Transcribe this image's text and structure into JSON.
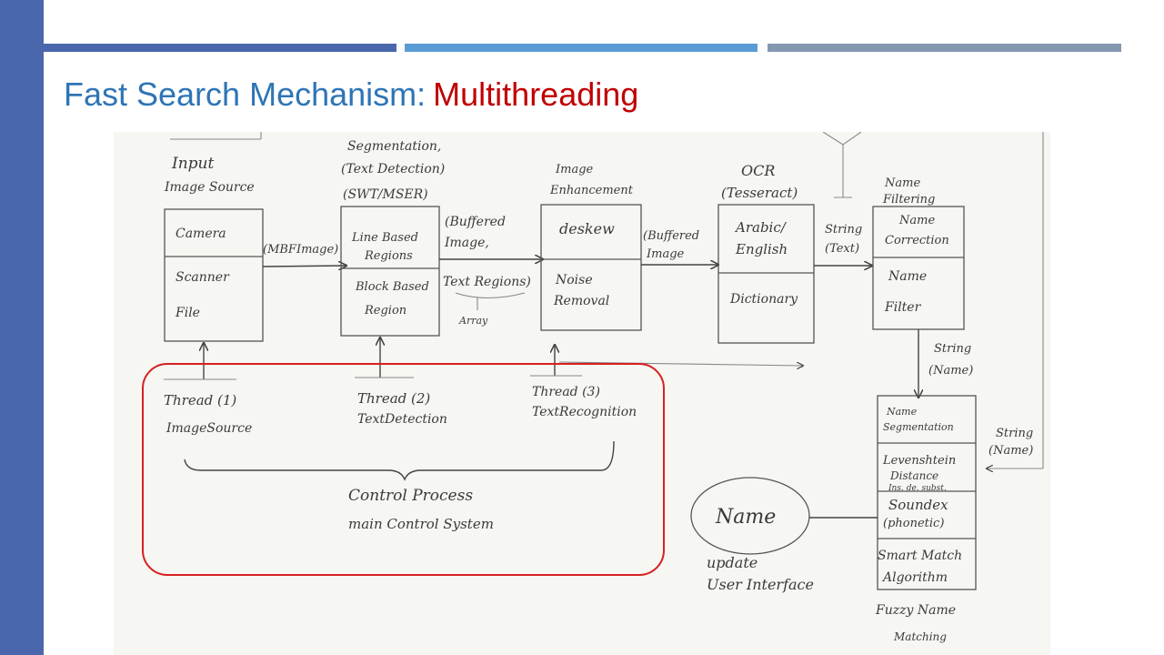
{
  "slide": {
    "title_part1": "Fast Search Mechanism:",
    "title_part2": "Multithreading",
    "colors": {
      "left_bar": "#4a66ac",
      "accent_1": "#4a66ac",
      "accent_2": "#5a9bd5",
      "accent_3": "#8497b0",
      "title_blue": "#2e75b6",
      "title_red": "#c00000",
      "highlight": "#d62020"
    }
  },
  "diagram": {
    "input": {
      "title1": "Input",
      "title2": "Image Source",
      "cell1": "Camera",
      "cell2": "Scanner",
      "cell3": "File"
    },
    "arrow1": "(MBFImage)",
    "segmentation": {
      "title1": "Segmentation,",
      "title2": "(Text Detection)",
      "title3": "(SWT/MSER)",
      "cell1a": "Line Based",
      "cell1b": "Regions",
      "cell2a": "Block Based",
      "cell2b": "Region"
    },
    "arrow2": {
      "line1": "(Buffered",
      "line2": "Image,",
      "line3": "Text Regions)",
      "line4": "Array"
    },
    "enhancement": {
      "title1": "Image",
      "title2": "Enhancement",
      "cell1": "deskew",
      "cell2a": "Noise",
      "cell2b": "Removal"
    },
    "arrow3": {
      "line1": "(Buffered",
      "line2": "Image"
    },
    "ocr": {
      "title1": "OCR",
      "title2": "(Tesseract)",
      "cell1a": "Arabic/",
      "cell1b": "English",
      "cell2": "Dictionary"
    },
    "arrow4": {
      "line1": "String",
      "line2": "(Text)"
    },
    "name_filtering": {
      "title1": "Name",
      "title2": "Filtering",
      "cell1a": "Name",
      "cell1b": "Correction",
      "cell2a": "Name",
      "cell2b": "Filter"
    },
    "arrow5": {
      "line1": "String",
      "line2": "(Name)"
    },
    "fuzzy": {
      "cell1a": "Name",
      "cell1b": "Segmentation",
      "cell2a": "Levenshtein",
      "cell2b": "Distance",
      "cell2c": "Ins. de. subst.",
      "cell3a": "Soundex",
      "cell3b": "(phonetic)",
      "cell4a": "Smart Match",
      "cell4b": "Algorithm",
      "label1": "Fuzzy Name",
      "label2": "Matching"
    },
    "side_note": {
      "line1": "String",
      "line2": "(Name)"
    },
    "name_node": {
      "label": "Name",
      "note1": "update",
      "note2": "User Interface"
    },
    "threads": [
      {
        "label": "Thread (1)",
        "sub": "ImageSource"
      },
      {
        "label": "Thread (2)",
        "sub": "TextDetection"
      },
      {
        "label": "Thread (3)",
        "sub": "TextRecognition"
      }
    ],
    "control": {
      "line1": "Control Process",
      "line2": "main Control System"
    }
  }
}
